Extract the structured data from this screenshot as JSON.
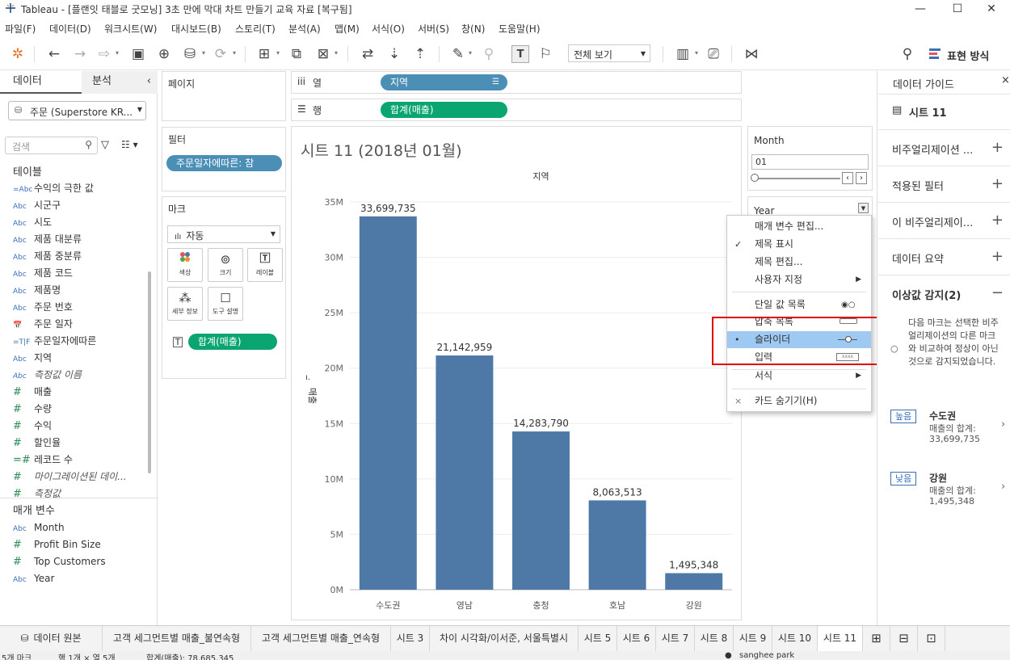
{
  "window": {
    "title": "Tableau - [플랜잇 태블로 굿모닝] 3초 만에 막대 차트 만들기 교육 자료 [복구됨]"
  },
  "menu": [
    "파일(F)",
    "데이터(D)",
    "워크시트(W)",
    "대시보드(B)",
    "스토리(T)",
    "분석(A)",
    "맵(M)",
    "서식(O)",
    "서버(S)",
    "창(N)",
    "도움말(H)"
  ],
  "toolbar": {
    "view_select": "전체 보기",
    "show_me": "표현 방식"
  },
  "left_pane": {
    "tab_data": "데이터",
    "tab_analysis": "분석",
    "datasource": "주문 (Superstore KR...",
    "search_placeholder": "검색",
    "tables_header": "테이블",
    "fields": [
      {
        "icon": "=Abc",
        "name": "수익의 극한 값"
      },
      {
        "icon": "Abc",
        "name": "시군구"
      },
      {
        "icon": "Abc",
        "name": "시도"
      },
      {
        "icon": "Abc",
        "name": "제품 대분류"
      },
      {
        "icon": "Abc",
        "name": "제품 중분류"
      },
      {
        "icon": "Abc",
        "name": "제품 코드"
      },
      {
        "icon": "Abc",
        "name": "제품명"
      },
      {
        "icon": "Abc",
        "name": "주문 번호"
      },
      {
        "icon": "📅",
        "name": "주문 일자"
      },
      {
        "icon": "=T|F",
        "name": "주문일자에따른"
      },
      {
        "icon": "Abc",
        "name": "지역"
      },
      {
        "icon": "Abc",
        "name": "측정값 이름",
        "italic": true
      },
      {
        "icon": "#",
        "name": "매출"
      },
      {
        "icon": "#",
        "name": "수량"
      },
      {
        "icon": "#",
        "name": "수익"
      },
      {
        "icon": "#",
        "name": "할인율"
      },
      {
        "icon": "=#",
        "name": "레코드 수"
      },
      {
        "icon": "#",
        "name": "마이그레이션된 데이...",
        "italic": true
      },
      {
        "icon": "#",
        "name": "측정값",
        "italic": true
      }
    ],
    "params_header": "매개 변수",
    "params": [
      {
        "icon": "Abc",
        "name": "Month"
      },
      {
        "icon": "#",
        "name": "Profit Bin Size"
      },
      {
        "icon": "#",
        "name": "Top Customers"
      },
      {
        "icon": "Abc",
        "name": "Year"
      }
    ]
  },
  "shelves": {
    "pages": "페이지",
    "filters": "필터",
    "filter_pill": "주문일자에따른: 참",
    "marks": "마크",
    "mark_type": "자동",
    "mark_buttons": [
      "색상",
      "크기",
      "레이블",
      "세부 정보",
      "도구 설명"
    ],
    "mark_pill": "합계(매출)",
    "columns_label": "열",
    "columns_pill": "지역",
    "rows_label": "행",
    "rows_pill": "합계(매출)"
  },
  "sheet": {
    "title": "시트 11 (2018년 01월)"
  },
  "chart_data": {
    "type": "bar",
    "title": "",
    "column_header": "지역",
    "ylabel": "매출",
    "categories": [
      "수도권",
      "영남",
      "충청",
      "호남",
      "강원"
    ],
    "values": [
      33699735,
      21142959,
      14283790,
      8063513,
      1495348
    ],
    "data_labels": [
      "33,699,735",
      "21,142,959",
      "14,283,790",
      "8,063,513",
      "1,495,348"
    ],
    "y_ticks": [
      "0M",
      "5M",
      "10M",
      "15M",
      "20M",
      "25M",
      "30M",
      "35M"
    ],
    "ylim": [
      0,
      35000000
    ],
    "bar_color": "#4e79a7",
    "grid": true
  },
  "param_card": {
    "month_label": "Month",
    "month_value": "01",
    "year_label": "Year"
  },
  "context_menu": {
    "items": [
      {
        "label": "매개 변수 편집...",
        "check": ""
      },
      {
        "label": "제목 표시",
        "check": "✓"
      },
      {
        "label": "제목 편집...",
        "check": ""
      },
      {
        "label": "사용자 지정",
        "check": "",
        "submenu": true
      },
      {
        "label": "단일 값 목록",
        "check": ""
      },
      {
        "label": "압축 목록",
        "check": ""
      },
      {
        "label": "슬라이더",
        "check": "•"
      },
      {
        "label": "입력",
        "check": ""
      },
      {
        "label": "서식",
        "check": "",
        "submenu": true
      },
      {
        "label": "카드 숨기기(H)",
        "check": "×"
      }
    ]
  },
  "right_pane": {
    "header": "데이터 가이드",
    "sheet": "시트 11",
    "sections": [
      "비주얼리제이션 ...",
      "적용된 필터",
      "이 비주얼리제이...",
      "데이터 요약",
      "이상값 감지(2)"
    ],
    "outlier_text": "다음 마크는 선택한 비주얼리제이션의 다른 마크와 비교하여 정상이 아닌 것으로 감지되었습니다.",
    "high_badge": "높음",
    "high_name": "수도권",
    "high_metric": "매출의 합계:",
    "high_value": "33,699,735",
    "low_badge": "낮음",
    "low_name": "강원",
    "low_metric": "매출의 합계:",
    "low_value": "1,495,348"
  },
  "tabs": [
    "데이터 원본",
    "고객 세그먼트별 매출_불연속형",
    "고객 세그먼트별 매출_연속형",
    "시트 3",
    "차이 시각화/이서준, 서울특별시",
    "시트 5",
    "시트 6",
    "시트 7",
    "시트 8",
    "시트 9",
    "시트 10",
    "시트 11"
  ],
  "status": {
    "marks": "5개 마크",
    "rows_cols": "행 1개 × 열 5개",
    "sum": "합계(매출): 78,685,345",
    "user": "sanghee park"
  }
}
